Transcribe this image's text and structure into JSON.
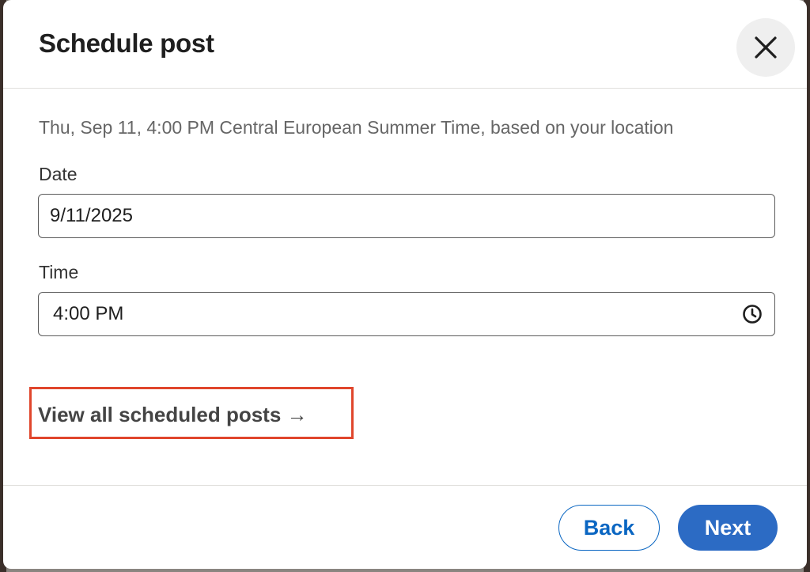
{
  "modal": {
    "title": "Schedule post",
    "close_icon": "close-icon"
  },
  "body": {
    "timezone_note": "Thu, Sep 11, 4:00 PM Central European Summer Time, based on your location",
    "date": {
      "label": "Date",
      "value": "9/11/2025"
    },
    "time": {
      "label": "Time",
      "value": "4:00 PM",
      "icon": "clock-icon"
    },
    "view_scheduled_link": "View all scheduled posts →"
  },
  "footer": {
    "back_label": "Back",
    "next_label": "Next"
  },
  "colors": {
    "primary": "#0a66c2",
    "primary_fill": "#2c6bc4",
    "highlight": "#e0462c"
  }
}
